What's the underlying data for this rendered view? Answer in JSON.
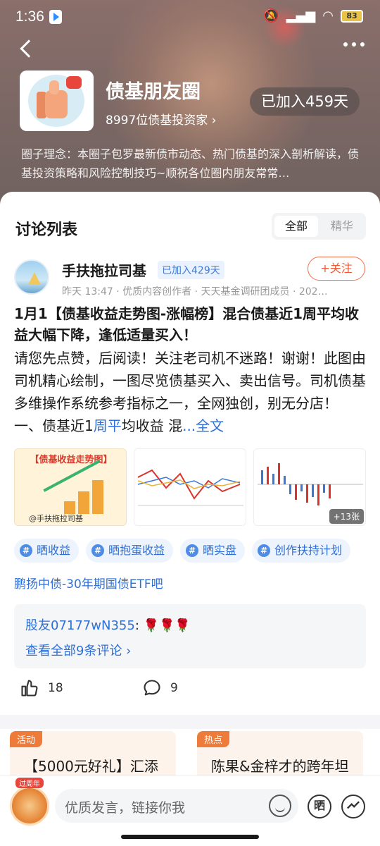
{
  "status": {
    "time": "1:36",
    "battery": "83"
  },
  "group": {
    "name": "债基朋友圈",
    "members": "8997位债基投资家",
    "joined": "已加入459天",
    "description": "圈子理念：本圈子包罗最新债市动态、热门债基的深入剖析解读，债基投资策略和风险控制技巧~顺祝各位圈内朋友常常…"
  },
  "list": {
    "title": "讨论列表",
    "tabs": [
      "全部",
      "精华"
    ]
  },
  "post": {
    "author": "手扶拖拉司基",
    "joined": "已加入429天",
    "follow": "+关注",
    "meta": "昨天 13:47 · 优质内容创作者 · 天天基金调研团成员 · 202…",
    "title": "1月1【债基收益走势图-涨幅榜】混合债基近1周平均收益大幅下降，逢低适量买入！",
    "body_main": "请您先点赞，后阅读！关注老司机不迷路！谢谢！此图由司机精心绘制，一图尽览债基买入、卖出信号。司机债基多维操作系统参考指标之一，全网独创，别无分店！ 一、债基近1",
    "body_link": "周平",
    "body_tail": "均收益 混",
    "full_text": "...全文",
    "image1_title": "【债基收益走势图】",
    "image1_caption": "@手扶拖拉司基",
    "image_more": "+13张",
    "tags": [
      "晒收益",
      "晒抱蛋收益",
      "晒实盘",
      "创作扶持计划"
    ],
    "bar_link": "鹏扬中债-30年期国债ETF吧",
    "comment_user": "股友07177wN355",
    "comment_text": ": 🌹🌹🌹",
    "view_all": "查看全部9条评论 ›",
    "likes": "18",
    "comments": "9"
  },
  "cards": [
    {
      "badge": "活动",
      "text": "【5000元好礼】汇添"
    },
    {
      "badge": "热点",
      "text": "陈果&金梓才的跨年坦"
    }
  ],
  "bottom": {
    "avatar_tag": "过周年",
    "placeholder": "优质发言，链接你我",
    "share_label": "晒"
  },
  "icons": {
    "back": "chevron-left-icon",
    "more": "more-dots-icon",
    "like": "thumb-up-icon",
    "comment": "comment-bubble-icon",
    "emoji": "emoji-icon",
    "trend": "trend-icon"
  },
  "colors": {
    "accent_blue": "#2f6fd6",
    "follow_orange": "#ef5a34",
    "badge_orange": "#ef7b3a"
  }
}
